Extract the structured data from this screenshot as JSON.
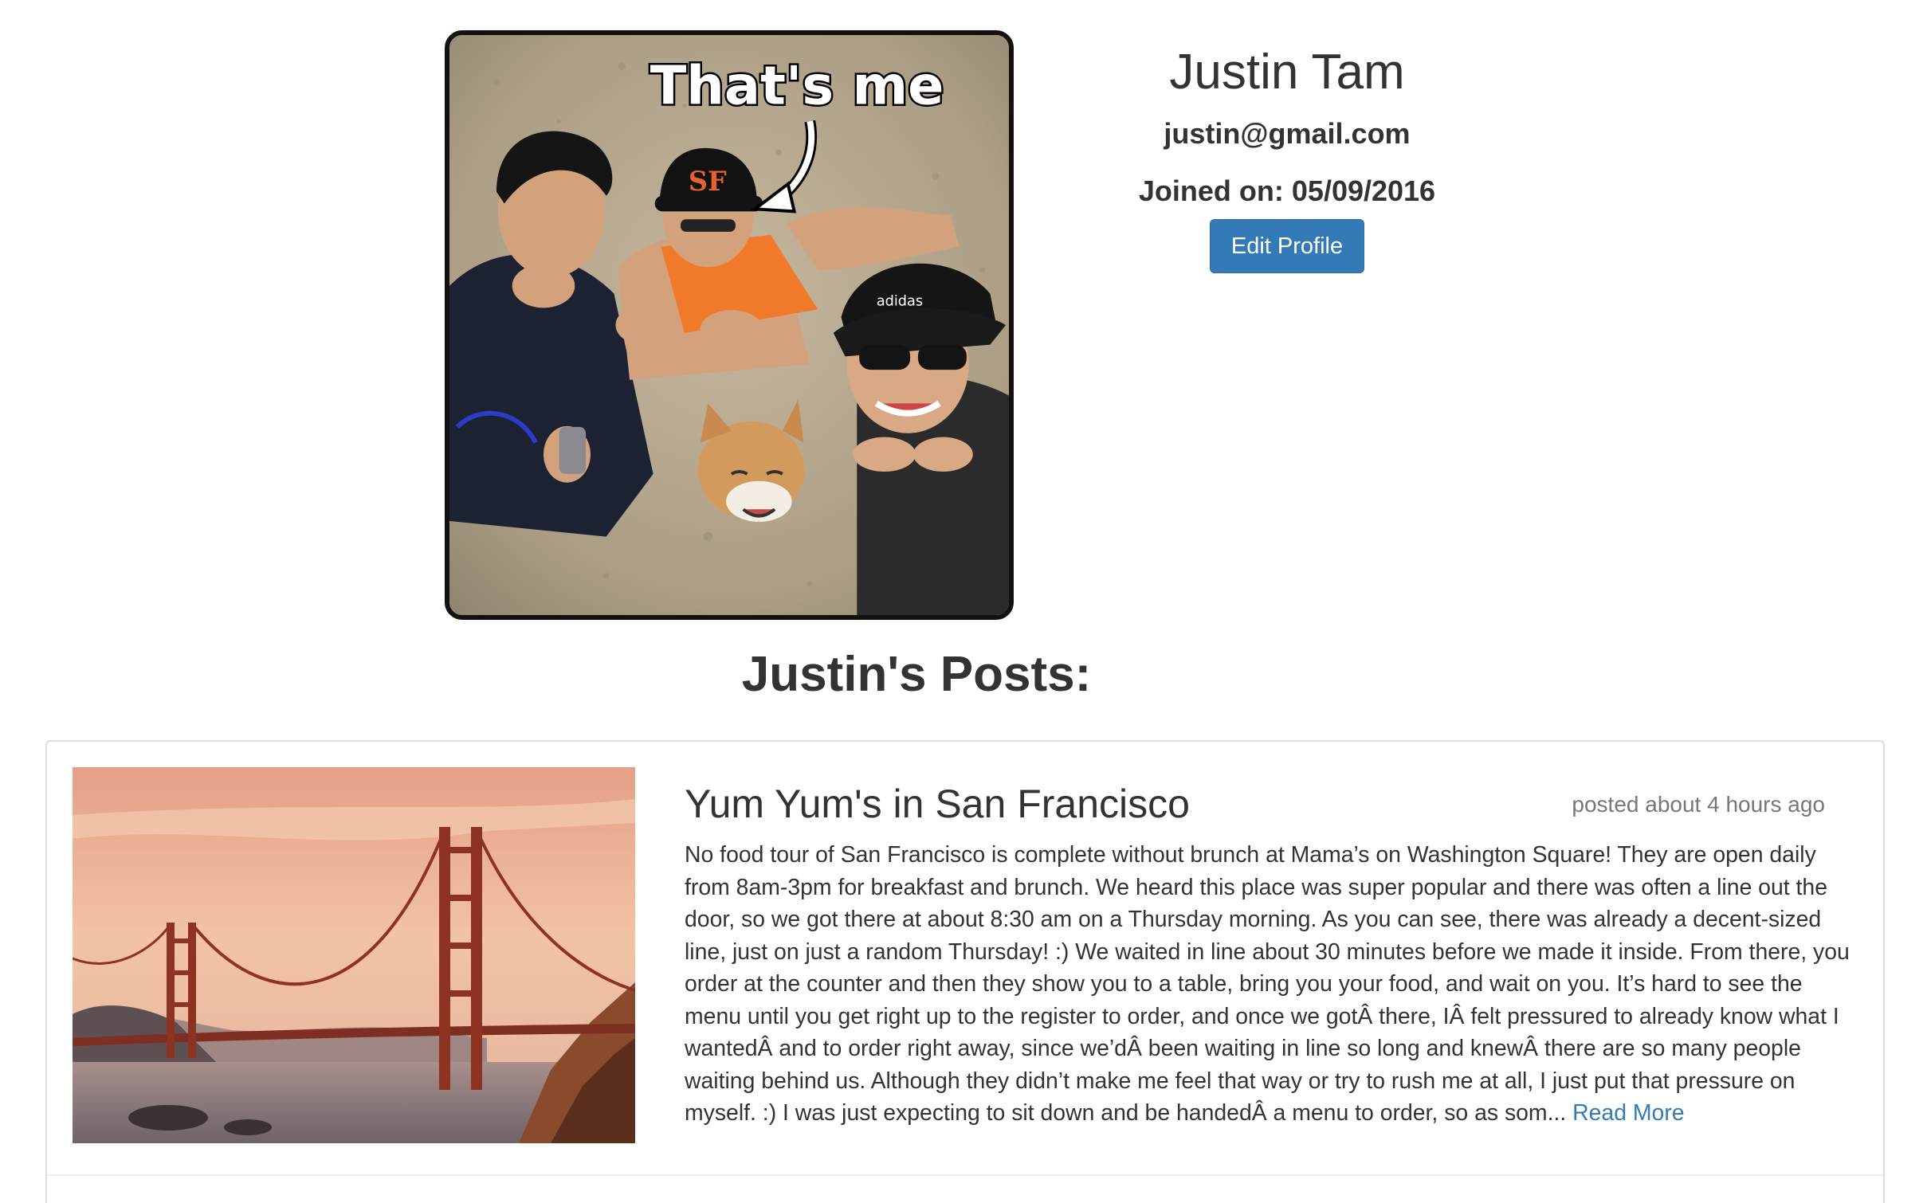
{
  "profile": {
    "photo_caption": "That's me",
    "name": "Justin Tam",
    "email": "justin@gmail.com",
    "joined": "Joined on: 05/09/2016",
    "edit_button": "Edit Profile"
  },
  "posts_section": {
    "heading": "Justin's Posts:"
  },
  "posts": [
    {
      "title": "Yum Yum's in San Francisco",
      "time": "posted about 4 hours ago",
      "excerpt": "No food tour of San Francisco is complete without brunch at Mama’s on Washington Square! They are open daily from 8am-3pm for breakfast and brunch. We heard this place was super popular and there was often a line out the door, so we got there at about 8:30 am on a Thursday morning. As you can see, there was already a decent-sized line, just on just a random Thursday! :) We waited in line about 30 minutes before we made it inside. From there, you order at the counter and then they show you to a table, bring you your food, and wait on you. It’s hard to see the menu until you get right up to the register to order, and once we gotÂ there, IÂ felt pressured to already know what I wantedÂ and to order right away, since we’dÂ been waiting in line so long and knewÂ there are so many people waiting behind us. Although they didn’t make me feel that way or try to rush me at all, I just put that pressure on myself. :) I was just expecting to sit down and be handedÂ a menu to order, so as som...",
      "read_more": "Read More"
    }
  ],
  "colors": {
    "primary": "#337ab7",
    "muted": "#777777",
    "text": "#333333",
    "border": "#dddddd"
  }
}
